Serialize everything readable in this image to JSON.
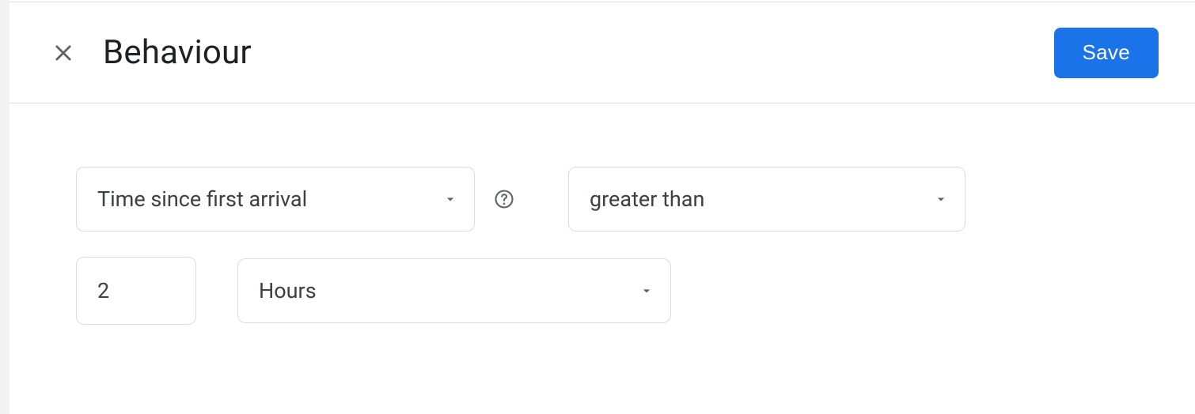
{
  "header": {
    "title": "Behaviour",
    "save_label": "Save"
  },
  "form": {
    "condition_select": {
      "value": "Time since first arrival"
    },
    "operator_select": {
      "value": "greater than"
    },
    "amount_input": {
      "value": "2"
    },
    "unit_select": {
      "value": "Hours"
    }
  }
}
